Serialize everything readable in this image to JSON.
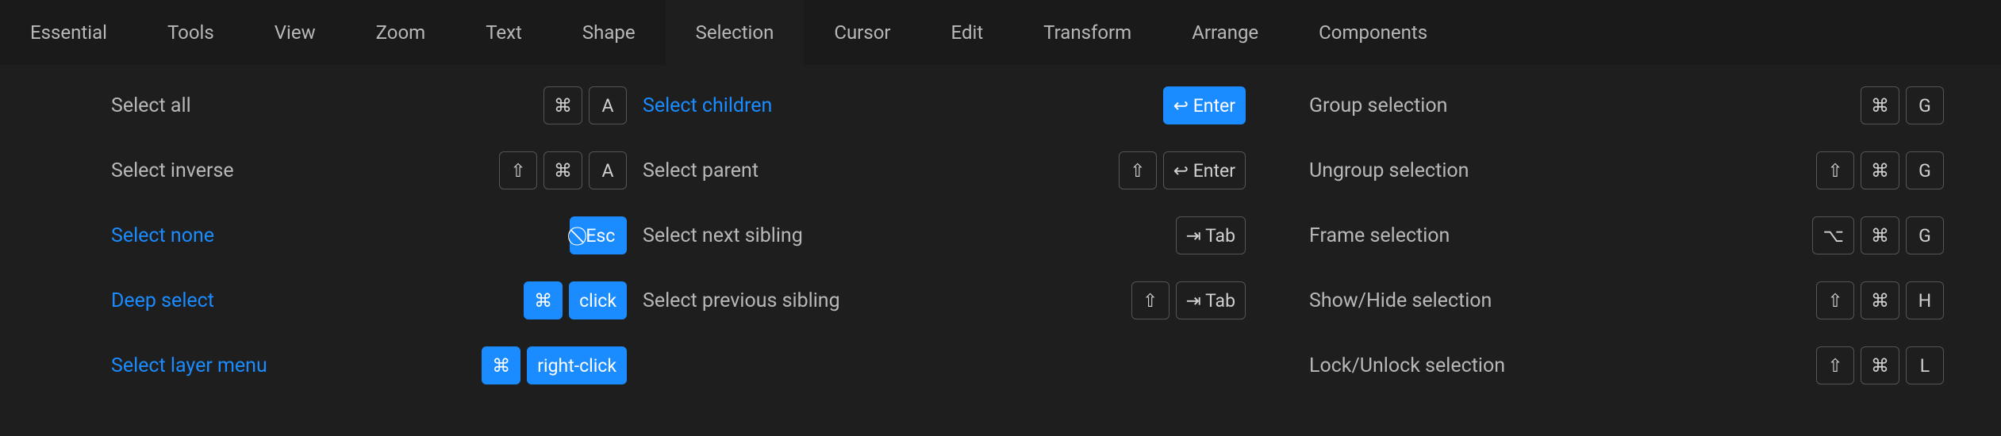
{
  "tabs": [
    {
      "label": "Essential",
      "active": false
    },
    {
      "label": "Tools",
      "active": false
    },
    {
      "label": "View",
      "active": false
    },
    {
      "label": "Zoom",
      "active": false
    },
    {
      "label": "Text",
      "active": false
    },
    {
      "label": "Shape",
      "active": false
    },
    {
      "label": "Selection",
      "active": true
    },
    {
      "label": "Cursor",
      "active": false
    },
    {
      "label": "Edit",
      "active": false
    },
    {
      "label": "Transform",
      "active": false
    },
    {
      "label": "Arrange",
      "active": false
    },
    {
      "label": "Components",
      "active": false
    }
  ],
  "columns": [
    [
      {
        "label": "Select all",
        "highlight": false,
        "keys": [
          {
            "g": "⌘"
          },
          {
            "g": "A"
          }
        ]
      },
      {
        "label": "Select inverse",
        "highlight": false,
        "keys": [
          {
            "g": "⇧"
          },
          {
            "g": "⌘"
          },
          {
            "g": "A"
          }
        ]
      },
      {
        "label": "Select none",
        "highlight": true,
        "keys": [
          {
            "g": "⃠ Esc",
            "wide": true
          }
        ]
      },
      {
        "label": "Deep select",
        "highlight": true,
        "keys": [
          {
            "g": "⌘"
          },
          {
            "g": "click",
            "wide": true
          }
        ]
      },
      {
        "label": "Select layer menu",
        "highlight": true,
        "keys": [
          {
            "g": "⌘"
          },
          {
            "g": "right-click",
            "wide": true
          }
        ]
      }
    ],
    [
      {
        "label": "Select children",
        "highlight": true,
        "keys": [
          {
            "g": "↩ Enter",
            "wide": true
          }
        ]
      },
      {
        "label": "Select parent",
        "highlight": false,
        "keys": [
          {
            "g": "⇧"
          },
          {
            "g": "↩ Enter",
            "wide": true
          }
        ]
      },
      {
        "label": "Select next sibling",
        "highlight": false,
        "keys": [
          {
            "g": "⇥ Tab",
            "wide": true
          }
        ]
      },
      {
        "label": "Select previous sibling",
        "highlight": false,
        "keys": [
          {
            "g": "⇧"
          },
          {
            "g": "⇥ Tab",
            "wide": true
          }
        ]
      }
    ],
    [
      {
        "label": "Group selection",
        "highlight": false,
        "keys": [
          {
            "g": "⌘"
          },
          {
            "g": "G"
          }
        ]
      },
      {
        "label": "Ungroup selection",
        "highlight": false,
        "keys": [
          {
            "g": "⇧"
          },
          {
            "g": "⌘"
          },
          {
            "g": "G"
          }
        ]
      },
      {
        "label": "Frame selection",
        "highlight": false,
        "keys": [
          {
            "g": "⌥"
          },
          {
            "g": "⌘"
          },
          {
            "g": "G"
          }
        ]
      },
      {
        "label": "Show/Hide selection",
        "highlight": false,
        "keys": [
          {
            "g": "⇧"
          },
          {
            "g": "⌘"
          },
          {
            "g": "H"
          }
        ]
      },
      {
        "label": "Lock/Unlock selection",
        "highlight": false,
        "keys": [
          {
            "g": "⇧"
          },
          {
            "g": "⌘"
          },
          {
            "g": "L"
          }
        ]
      }
    ]
  ]
}
